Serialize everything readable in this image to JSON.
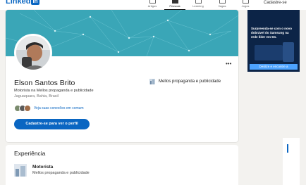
{
  "header": {
    "logo_text": "Linked",
    "logo_badge": "in",
    "nav": [
      {
        "label": "Artigos",
        "icon": "newspaper-icon",
        "active": false
      },
      {
        "label": "Pessoas",
        "icon": "people-icon",
        "active": true
      },
      {
        "label": "Learning",
        "icon": "play-icon",
        "active": false
      },
      {
        "label": "Vagas",
        "icon": "briefcase-icon",
        "active": false
      },
      {
        "label": "Jogos",
        "icon": "puzzle-icon",
        "active": false
      }
    ],
    "signup_label": "Cadastre-se"
  },
  "profile": {
    "name": "Elson Santos Brito",
    "headline": "Motorista na Mellos propaganda e publicidade",
    "location": "Jaguaquara, Bahia, Brasil",
    "connections_link": "Veja suas conexões em comum",
    "cta_label": "Cadastre-se para ver o perfil",
    "more_label": "•••",
    "current_company": "Mellos propaganda e publicidade"
  },
  "ad": {
    "text": "Surpreenda-se com o novo dobrável do Samsung na rede líder em 5G.",
    "button_label": "Deslize e encontre a"
  },
  "experience": {
    "section_title": "Experiência",
    "items": [
      {
        "role": "Motorista",
        "company": "Mellos propaganda e publicidade"
      }
    ]
  },
  "colors": {
    "brand": "#0a66c2",
    "banner": "#3aa6b7",
    "ad_background": "#0c2447"
  }
}
